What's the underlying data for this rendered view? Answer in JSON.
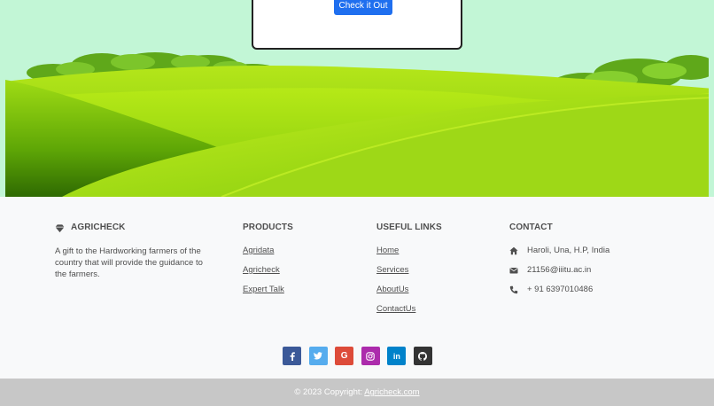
{
  "hero": {
    "cta_label": "Check it Out"
  },
  "brand": {
    "name": "AGRICHECK",
    "description": "A gift to the Hardworking farmers of the country that will provide the guidance to the farmers."
  },
  "products": {
    "heading": "PRODUCTS",
    "items": [
      "Agridata",
      "Agricheck",
      "Expert Talk"
    ]
  },
  "useful_links": {
    "heading": "USEFUL LINKS",
    "items": [
      "Home",
      "Services",
      "AboutUs",
      "ContactUs"
    ]
  },
  "contact": {
    "heading": "CONTACT",
    "address": "Haroli, Una, H.P, India",
    "email": "21156@iiitu.ac.in",
    "phone": "+ 91 6397010486"
  },
  "socials": [
    {
      "icon": "facebook-icon",
      "glyph": "f",
      "color": "#3b5998"
    },
    {
      "icon": "twitter-icon",
      "glyph": "t",
      "color": "#55acee"
    },
    {
      "icon": "google-icon",
      "glyph": "G",
      "color": "#dd4b39"
    },
    {
      "icon": "instagram-icon",
      "glyph": "◎",
      "color": "#ac2bac"
    },
    {
      "icon": "linkedin-icon",
      "glyph": "in",
      "color": "#0082ca"
    },
    {
      "icon": "github-icon",
      "glyph": "●",
      "color": "#333333"
    }
  ],
  "copyright": {
    "prefix": "© 2023 Copyright: ",
    "link": "Agricheck.com"
  }
}
